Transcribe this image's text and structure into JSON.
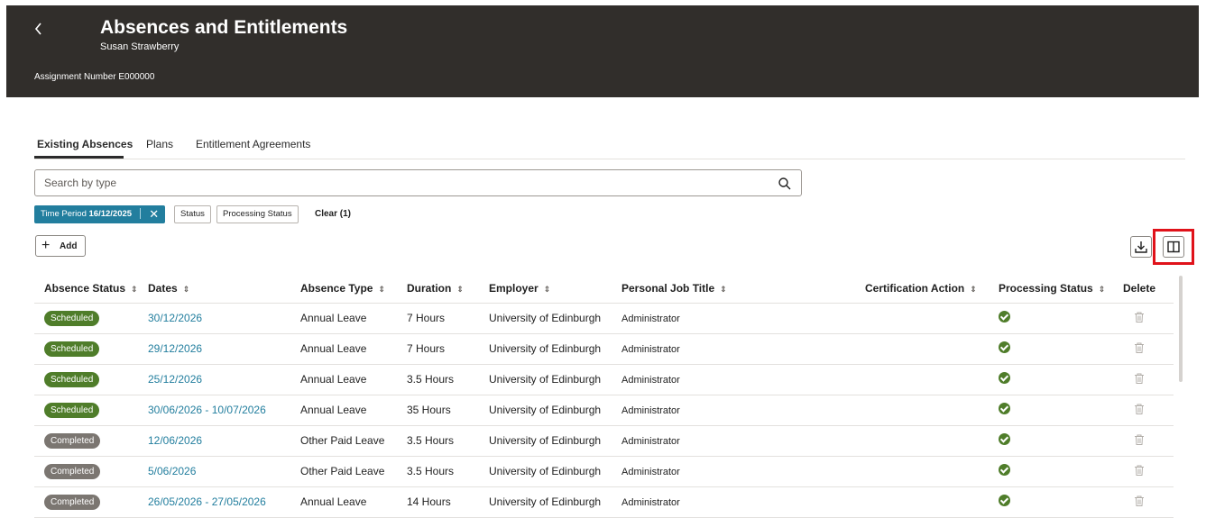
{
  "header": {
    "back_icon": "chevron-left-icon",
    "title": "Absences and Entitlements",
    "subtitle": "Susan Strawberry",
    "assignment": "Assignment Number E000000",
    "background": "#312e2b"
  },
  "tabs": [
    {
      "label": "Existing Absences",
      "active": true
    },
    {
      "label": "Plans",
      "active": false
    },
    {
      "label": "Entitlement Agreements",
      "active": false
    }
  ],
  "search": {
    "placeholder": "Search by type",
    "value": "",
    "icon": "search-icon"
  },
  "filters": {
    "time_period": {
      "label": "Time Period",
      "value": "16/12/2025"
    },
    "status": "Status",
    "processing_status": "Processing Status",
    "clear": "Clear (1)"
  },
  "toolbar": {
    "add_label": "Add",
    "download_icon": "download-icon",
    "columns_icon": "split-view-icon"
  },
  "table": {
    "headers": [
      "Absence Status",
      "Dates",
      "Absence Type",
      "Duration",
      "Employer",
      "Personal Job Title",
      "Certification Action",
      "Processing Status",
      "Delete"
    ],
    "rows": [
      {
        "status": "Scheduled",
        "dates": "30/12/2026",
        "type": "Annual Leave",
        "duration": "7 Hours",
        "employer": "University of Edinburgh",
        "job_title": "Administrator",
        "certification": ""
      },
      {
        "status": "Scheduled",
        "dates": "29/12/2026",
        "type": "Annual Leave",
        "duration": "7 Hours",
        "employer": "University of Edinburgh",
        "job_title": "Administrator",
        "certification": ""
      },
      {
        "status": "Scheduled",
        "dates": "25/12/2026",
        "type": "Annual Leave",
        "duration": "3.5 Hours",
        "employer": "University of Edinburgh",
        "job_title": "Administrator",
        "certification": ""
      },
      {
        "status": "Scheduled",
        "dates": "30/06/2026 - 10/07/2026",
        "type": "Annual Leave",
        "duration": "35 Hours",
        "employer": "University of Edinburgh",
        "job_title": "Administrator",
        "certification": ""
      },
      {
        "status": "Completed",
        "dates": "12/06/2026",
        "type": "Other Paid Leave",
        "duration": "3.5 Hours",
        "employer": "University of Edinburgh",
        "job_title": "Administrator",
        "certification": ""
      },
      {
        "status": "Completed",
        "dates": "5/06/2026",
        "type": "Other Paid Leave",
        "duration": "3.5 Hours",
        "employer": "University of Edinburgh",
        "job_title": "Administrator",
        "certification": ""
      },
      {
        "status": "Completed",
        "dates": "26/05/2026 - 27/05/2026",
        "type": "Annual Leave",
        "duration": "14 Hours",
        "employer": "University of Edinburgh",
        "job_title": "Administrator",
        "certification": ""
      }
    ]
  },
  "colors": {
    "accent": "#227e9e",
    "scheduled": "#4f7d2a",
    "completed": "#7b7671",
    "highlight": "#e0121a"
  }
}
